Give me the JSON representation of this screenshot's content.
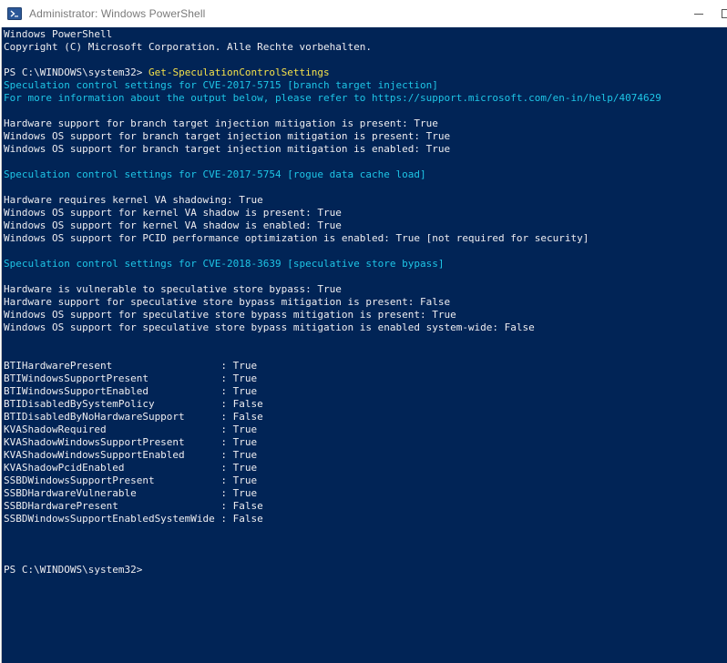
{
  "window": {
    "title": "Administrator: Windows PowerShell",
    "icon": "powershell-icon",
    "controls": [
      "minimize-icon",
      "maximize-icon"
    ],
    "colors": {
      "console_background": "#012456",
      "text": "#eeedf0",
      "highlight": "#1ec5e6",
      "command": "#f5e14a"
    }
  },
  "console": {
    "lines": [
      {
        "parts": [
          {
            "text": "Windows PowerShell",
            "color": "white"
          }
        ]
      },
      {
        "parts": [
          {
            "text": "Copyright (C) Microsoft Corporation. Alle Rechte vorbehalten.",
            "color": "white"
          }
        ]
      },
      {
        "parts": [
          {
            "text": "",
            "color": "white"
          }
        ]
      },
      {
        "parts": [
          {
            "text": "PS C:\\WINDOWS\\system32> ",
            "color": "white"
          },
          {
            "text": "Get-SpeculationControlSettings",
            "color": "yellow"
          }
        ]
      },
      {
        "parts": [
          {
            "text": "Speculation control settings for CVE-2017-5715 [branch target injection]",
            "color": "cyan"
          }
        ]
      },
      {
        "parts": [
          {
            "text": "For more information about the output below, please refer to https://support.microsoft.com/en-in/help/4074629",
            "color": "cyan"
          }
        ]
      },
      {
        "parts": [
          {
            "text": "",
            "color": "white"
          }
        ]
      },
      {
        "parts": [
          {
            "text": "Hardware support for branch target injection mitigation is present: True",
            "color": "white"
          }
        ]
      },
      {
        "parts": [
          {
            "text": "Windows OS support for branch target injection mitigation is present: True",
            "color": "white"
          }
        ]
      },
      {
        "parts": [
          {
            "text": "Windows OS support for branch target injection mitigation is enabled: True",
            "color": "white"
          }
        ]
      },
      {
        "parts": [
          {
            "text": "",
            "color": "white"
          }
        ]
      },
      {
        "parts": [
          {
            "text": "Speculation control settings for CVE-2017-5754 [rogue data cache load]",
            "color": "cyan"
          }
        ]
      },
      {
        "parts": [
          {
            "text": "",
            "color": "white"
          }
        ]
      },
      {
        "parts": [
          {
            "text": "Hardware requires kernel VA shadowing: True",
            "color": "white"
          }
        ]
      },
      {
        "parts": [
          {
            "text": "Windows OS support for kernel VA shadow is present: True",
            "color": "white"
          }
        ]
      },
      {
        "parts": [
          {
            "text": "Windows OS support for kernel VA shadow is enabled: True",
            "color": "white"
          }
        ]
      },
      {
        "parts": [
          {
            "text": "Windows OS support for PCID performance optimization is enabled: True [not required for security]",
            "color": "white"
          }
        ]
      },
      {
        "parts": [
          {
            "text": "",
            "color": "white"
          }
        ]
      },
      {
        "parts": [
          {
            "text": "Speculation control settings for CVE-2018-3639 [speculative store bypass]",
            "color": "cyan"
          }
        ]
      },
      {
        "parts": [
          {
            "text": "",
            "color": "white"
          }
        ]
      },
      {
        "parts": [
          {
            "text": "Hardware is vulnerable to speculative store bypass: True",
            "color": "white"
          }
        ]
      },
      {
        "parts": [
          {
            "text": "Hardware support for speculative store bypass mitigation is present: False",
            "color": "white"
          }
        ]
      },
      {
        "parts": [
          {
            "text": "Windows OS support for speculative store bypass mitigation is present: True",
            "color": "white"
          }
        ]
      },
      {
        "parts": [
          {
            "text": "Windows OS support for speculative store bypass mitigation is enabled system-wide: False",
            "color": "white"
          }
        ]
      },
      {
        "parts": [
          {
            "text": "",
            "color": "white"
          }
        ]
      },
      {
        "parts": [
          {
            "text": "",
            "color": "white"
          }
        ]
      },
      {
        "parts": [
          {
            "text": "BTIHardwarePresent                  : True",
            "color": "white"
          }
        ]
      },
      {
        "parts": [
          {
            "text": "BTIWindowsSupportPresent            : True",
            "color": "white"
          }
        ]
      },
      {
        "parts": [
          {
            "text": "BTIWindowsSupportEnabled            : True",
            "color": "white"
          }
        ]
      },
      {
        "parts": [
          {
            "text": "BTIDisabledBySystemPolicy           : False",
            "color": "white"
          }
        ]
      },
      {
        "parts": [
          {
            "text": "BTIDisabledByNoHardwareSupport      : False",
            "color": "white"
          }
        ]
      },
      {
        "parts": [
          {
            "text": "KVAShadowRequired                   : True",
            "color": "white"
          }
        ]
      },
      {
        "parts": [
          {
            "text": "KVAShadowWindowsSupportPresent      : True",
            "color": "white"
          }
        ]
      },
      {
        "parts": [
          {
            "text": "KVAShadowWindowsSupportEnabled      : True",
            "color": "white"
          }
        ]
      },
      {
        "parts": [
          {
            "text": "KVAShadowPcidEnabled                : True",
            "color": "white"
          }
        ]
      },
      {
        "parts": [
          {
            "text": "SSBDWindowsSupportPresent           : True",
            "color": "white"
          }
        ]
      },
      {
        "parts": [
          {
            "text": "SSBDHardwareVulnerable              : True",
            "color": "white"
          }
        ]
      },
      {
        "parts": [
          {
            "text": "SSBDHardwarePresent                 : False",
            "color": "white"
          }
        ]
      },
      {
        "parts": [
          {
            "text": "SSBDWindowsSupportEnabledSystemWide : False",
            "color": "white"
          }
        ]
      },
      {
        "parts": [
          {
            "text": "",
            "color": "white"
          }
        ]
      },
      {
        "parts": [
          {
            "text": "",
            "color": "white"
          }
        ]
      },
      {
        "parts": [
          {
            "text": "",
            "color": "white"
          }
        ]
      },
      {
        "parts": [
          {
            "text": "PS C:\\WINDOWS\\system32>",
            "color": "white"
          }
        ]
      }
    ]
  }
}
